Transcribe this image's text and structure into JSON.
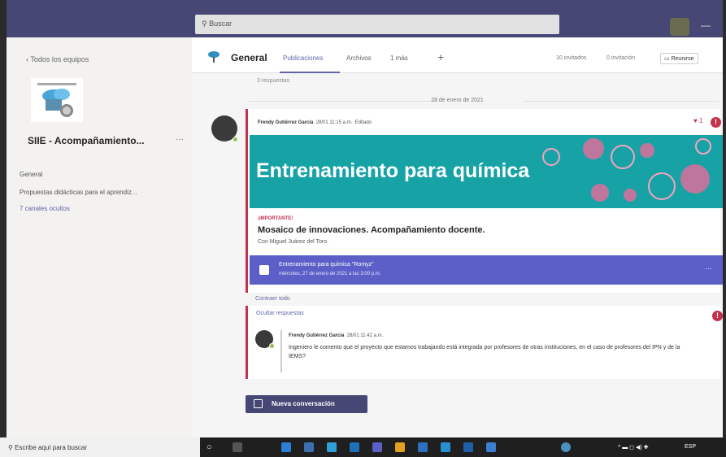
{
  "search": {
    "placeholder": "Buscar"
  },
  "sidebar": {
    "back_label": "Todos los equipos",
    "team_name": "SIIE - Acompañamiento...",
    "more": "···",
    "channels": [
      {
        "label": "General"
      },
      {
        "label": "Propuestas didácticas para el aprendiz..."
      },
      {
        "label": "7 canales ocultos"
      }
    ]
  },
  "header": {
    "title": "General",
    "tabs": [
      "Publicaciones",
      "Archivos",
      "1 más"
    ],
    "plus": "+",
    "right": [
      "10 invitados",
      "0 invitación"
    ],
    "meet": "Reunirse"
  },
  "feed": {
    "old_reply": "3 respuestas",
    "date_separator": "28 de enero de 2021",
    "post1": {
      "author": "Frendy Gutiérrez García",
      "time": "28/01 11:15 a.m.",
      "edited": "Editado",
      "reaction": "1",
      "banner": "Entrenamiento para química",
      "important": "¡IMPORTANTE!",
      "title": "Mosaico de innovaciones. Acompañamiento docente.",
      "subtitle": "Con Miguel Juárez del Toro.",
      "event_title": "Entrenamiento para química \"Romyz\"",
      "event_date": "miércoles, 27 de enero de 2021 a las 3:00 p.m.",
      "event_more": "···",
      "collapse": "Contraer todo",
      "replies": "Ocultar respuestas"
    },
    "post2": {
      "author": "Frendy Gutiérrez García",
      "time": "28/01 11:42 a.m.",
      "body": "Ingeniero le comento que el proyecto que estamos trabajando está integrada por profesores de otras instituciones, en el caso de profesores del IPN y de la IEMS?"
    },
    "alert": "!"
  },
  "new_conversation": "Nueva conversación",
  "taskbar": {
    "search": "Escribe aquí para buscar",
    "lang": "ESP"
  },
  "colors": {
    "topbar": "#464775",
    "accent": "#6264a7",
    "banner": "#17a3a6",
    "important": "#c4314b"
  }
}
